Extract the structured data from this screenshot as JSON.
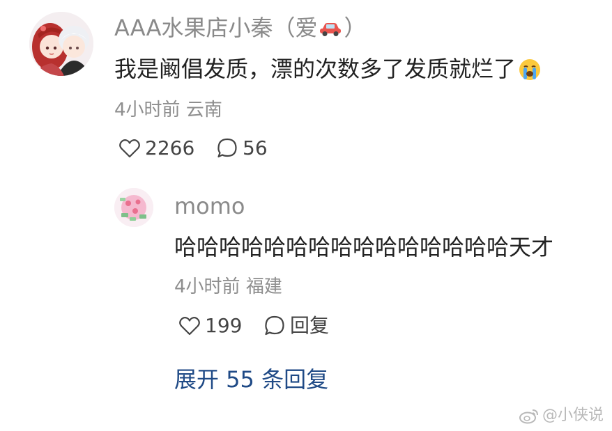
{
  "comment": {
    "username_prefix": "AAA水果店小秦（爱",
    "username_suffix": "）",
    "username_emoji": "car-icon",
    "text": "我是阚倡发质，漂的次数多了发质就烂了",
    "text_emoji": "crying-face-icon",
    "time": "4小时前",
    "location": "云南",
    "likes": "2266",
    "replies": "56"
  },
  "reply": {
    "username": "momo",
    "text": "哈哈哈哈哈哈哈哈哈哈哈哈哈哈哈天才",
    "time": "4小时前",
    "location": "福建",
    "likes": "199",
    "reply_label": "回复"
  },
  "expand_label": "展开 55 条回复",
  "watermark": "@小侠说",
  "colors": {
    "username": "#8a8a8a",
    "text": "#222222",
    "meta": "#8e8e8e",
    "link": "#1f4a86"
  }
}
